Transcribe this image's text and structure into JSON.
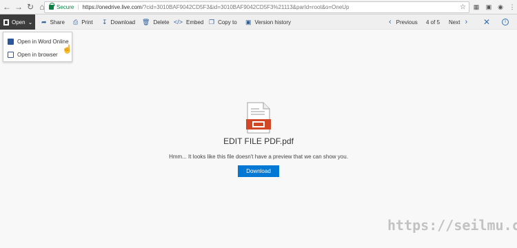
{
  "browser": {
    "secure_label": "Secure",
    "url_host": "https://onedrive.live.com",
    "url_rest": "/?cid=3010BAF9042CD5F3&id=3010BAF9042CD5F3%21113&parId=root&o=OneUp"
  },
  "toolbar": {
    "open_label": "Open",
    "share_label": "Share",
    "print_label": "Print",
    "download_label": "Download",
    "delete_label": "Delete",
    "embed_label": "Embed",
    "copy_label": "Copy to",
    "history_label": "Version history",
    "previous_label": "Previous",
    "position_label": "4 of 5",
    "next_label": "Next"
  },
  "open_menu": {
    "items": [
      {
        "label": "Open in Word Online"
      },
      {
        "label": "Open in browser"
      }
    ]
  },
  "preview": {
    "file_name": "EDIT FILE PDF.pdf",
    "message": "Hmm... It looks like this file doesn't have a preview that we can show you.",
    "download_button": "Download"
  },
  "watermark": "https://seilmu.com",
  "colors": {
    "accent": "#0078d4",
    "open_button": "#3c3c3c",
    "pdf_red": "#d24726"
  }
}
